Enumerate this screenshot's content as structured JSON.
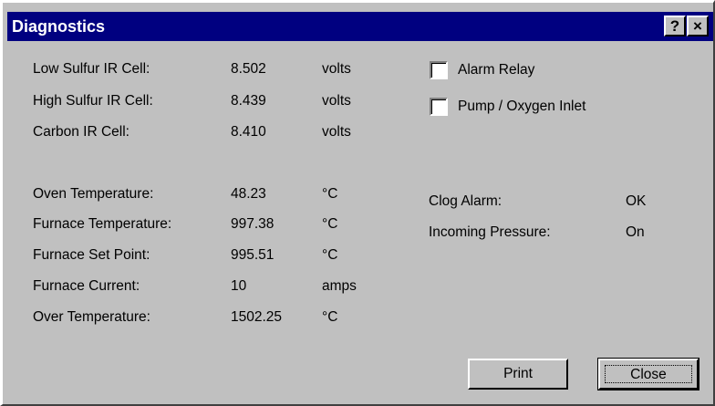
{
  "window": {
    "title": "Diagnostics",
    "help_glyph": "?",
    "close_glyph": "×"
  },
  "readings": [
    {
      "label": "Low Sulfur IR Cell:",
      "value": "8.502",
      "unit": "volts"
    },
    {
      "label": "High Sulfur IR Cell:",
      "value": "8.439",
      "unit": "volts"
    },
    {
      "label": "Carbon IR Cell:",
      "value": "8.410",
      "unit": "volts"
    },
    {
      "label": "Oven Temperature:",
      "value": "48.23",
      "unit": "°C"
    },
    {
      "label": "Furnace Temperature:",
      "value": "997.38",
      "unit": "°C"
    },
    {
      "label": "Furnace Set Point:",
      "value": "995.51",
      "unit": "°C"
    },
    {
      "label": "Furnace Current:",
      "value": "10",
      "unit": "amps"
    },
    {
      "label": "Over Temperature:",
      "value": "1502.25",
      "unit": "°C"
    }
  ],
  "checkboxes": [
    {
      "label": "Alarm Relay",
      "checked": false
    },
    {
      "label": "Pump / Oxygen Inlet",
      "checked": false
    }
  ],
  "status": [
    {
      "label": "Clog Alarm:",
      "value": "OK"
    },
    {
      "label": "Incoming Pressure:",
      "value": "On"
    }
  ],
  "buttons": {
    "print": "Print",
    "close": "Close"
  },
  "colors": {
    "titlebar": "#000080",
    "face": "#c0c0c0"
  }
}
